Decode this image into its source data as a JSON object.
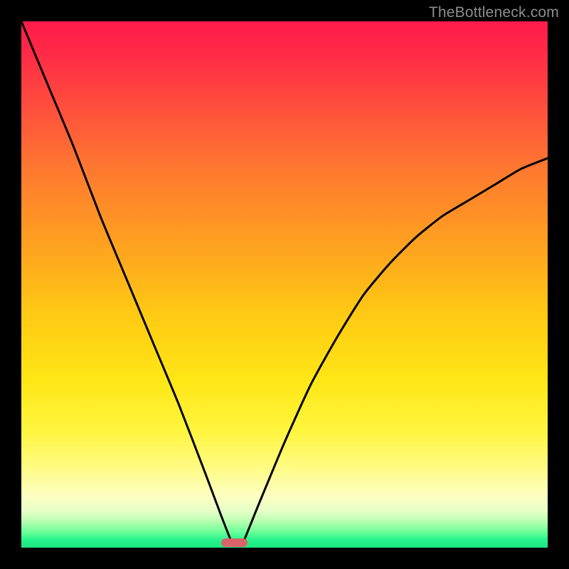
{
  "watermark": {
    "text": "TheBottleneck.com"
  },
  "chart_data": {
    "type": "line",
    "title": "",
    "xlabel": "",
    "ylabel": "",
    "xlim": [
      0,
      100
    ],
    "ylim": [
      0,
      100
    ],
    "grid": false,
    "legend": false,
    "series": [
      {
        "name": "bottleneck-curve",
        "x": [
          0,
          5,
          10,
          15,
          20,
          25,
          30,
          35,
          38,
          40,
          41,
          42,
          45,
          50,
          55,
          60,
          65,
          70,
          75,
          80,
          85,
          90,
          95,
          100
        ],
        "values": [
          100,
          88,
          76,
          63,
          51,
          39,
          27,
          14,
          6,
          1,
          0.5,
          0.7,
          8,
          20,
          31,
          40,
          48,
          54,
          59,
          63,
          66,
          69,
          72,
          74
        ]
      }
    ],
    "optimal_marker": {
      "x_percent": 40.5,
      "y_percent": 99.0,
      "width_percent": 5.0,
      "height_percent": 1.6
    },
    "background_gradient": {
      "top": "#ff1a4b",
      "mid": "#ffe615",
      "bottom": "#1be783"
    }
  }
}
